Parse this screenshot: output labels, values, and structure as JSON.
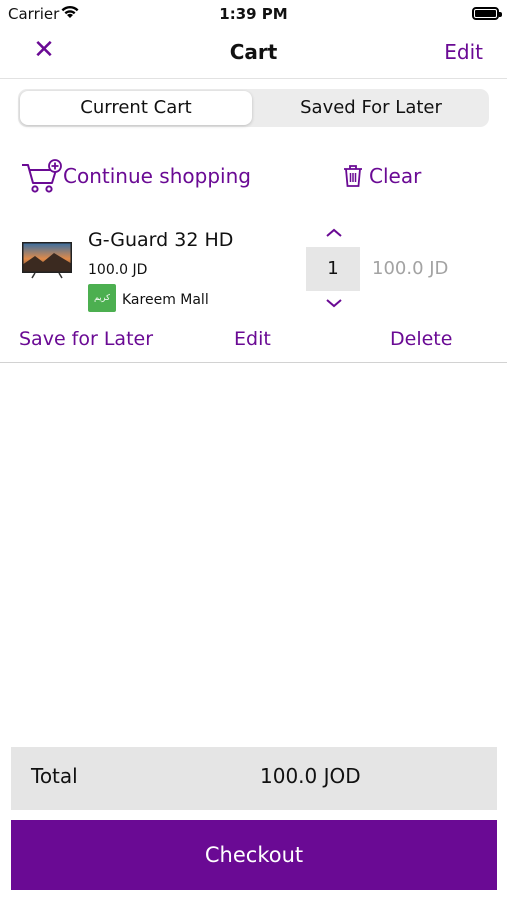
{
  "status_bar": {
    "carrier": "Carrier",
    "time": "1:39 PM"
  },
  "nav": {
    "title": "Cart",
    "edit_label": "Edit",
    "close_icon": "close-icon"
  },
  "segments": {
    "current": "Current Cart",
    "saved": "Saved For Later",
    "selected": "current"
  },
  "actions": {
    "continue_label": "Continue shopping",
    "clear_label": "Clear"
  },
  "item": {
    "name": "G-Guard 32 HD",
    "price": "100.0 JD",
    "store_name": "Kareem Mall",
    "quantity": "1",
    "line_total": "100.0 JD",
    "save_for_later": "Save for Later",
    "edit": "Edit",
    "delete": "Delete"
  },
  "summary": {
    "total_label": "Total",
    "total_value": "100.0 JOD",
    "checkout_label": "Checkout"
  },
  "colors": {
    "accent": "#6a0a94",
    "store_logo": "#4caf50",
    "bar_bg": "#e5e5e5"
  }
}
